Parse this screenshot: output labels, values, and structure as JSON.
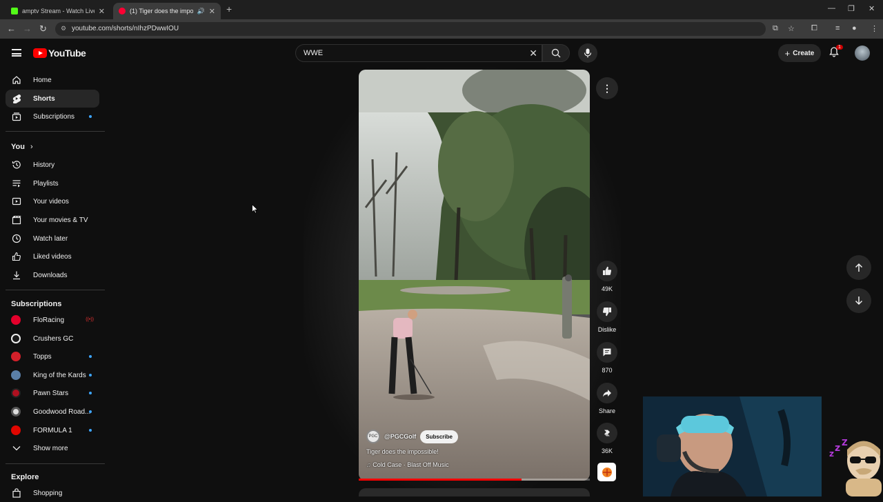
{
  "browser": {
    "tabs": [
      {
        "title": "amptv Stream - Watch Live on",
        "favicon_color": "#53fc18"
      },
      {
        "title": "(1) Tiger does the impossib",
        "favicon_color": "#ff0033"
      }
    ],
    "url": "youtube.com/shorts/nIhzPDwwIOU"
  },
  "header": {
    "logo_text": "YouTube",
    "search_query": "WWE",
    "create_label": "Create",
    "notification_count": "1"
  },
  "sidebar": {
    "main": [
      {
        "label": "Home",
        "icon": "home-icon"
      },
      {
        "label": "Shorts",
        "icon": "shorts-icon",
        "active": true
      },
      {
        "label": "Subscriptions",
        "icon": "subscriptions-icon"
      }
    ],
    "you_header": "You",
    "you_items": [
      {
        "label": "History",
        "icon": "history-icon"
      },
      {
        "label": "Playlists",
        "icon": "playlists-icon"
      },
      {
        "label": "Your videos",
        "icon": "your-videos-icon"
      },
      {
        "label": "Your movies & TV",
        "icon": "movies-icon"
      },
      {
        "label": "Watch later",
        "icon": "clock-icon"
      },
      {
        "label": "Liked videos",
        "icon": "thumbs-up-icon"
      },
      {
        "label": "Downloads",
        "icon": "download-icon"
      }
    ],
    "subscriptions_header": "Subscriptions",
    "subscriptions": [
      {
        "label": "FloRacing",
        "color": "#e4002b"
      },
      {
        "label": "Crushers GC",
        "color": "#1a1a1a"
      },
      {
        "label": "Topps",
        "color": "#d4202a"
      },
      {
        "label": "King of the Kards",
        "color": "#5a7fa8"
      },
      {
        "label": "Pawn Stars",
        "color": "#b01020"
      },
      {
        "label": "Goodwood Road...",
        "color": "#dddddd"
      },
      {
        "label": "FORMULA 1",
        "color": "#e10600"
      }
    ],
    "show_more": "Show more",
    "explore_header": "Explore",
    "explore_items": [
      {
        "label": "Shopping",
        "icon": "shopping-bag-icon"
      }
    ]
  },
  "short": {
    "channel_handle": "@PGCGolf",
    "channel_avatar_text": "PGC",
    "subscribe_label": "Subscribe",
    "title": "Tiger does the impossible!",
    "music": "Cold Case · Blast Off Music",
    "progress_fraction": 0.705,
    "actions": {
      "likes": "49K",
      "dislike_label": "Dislike",
      "comments": "870",
      "share_label": "Share",
      "remix_count": "36K"
    }
  }
}
